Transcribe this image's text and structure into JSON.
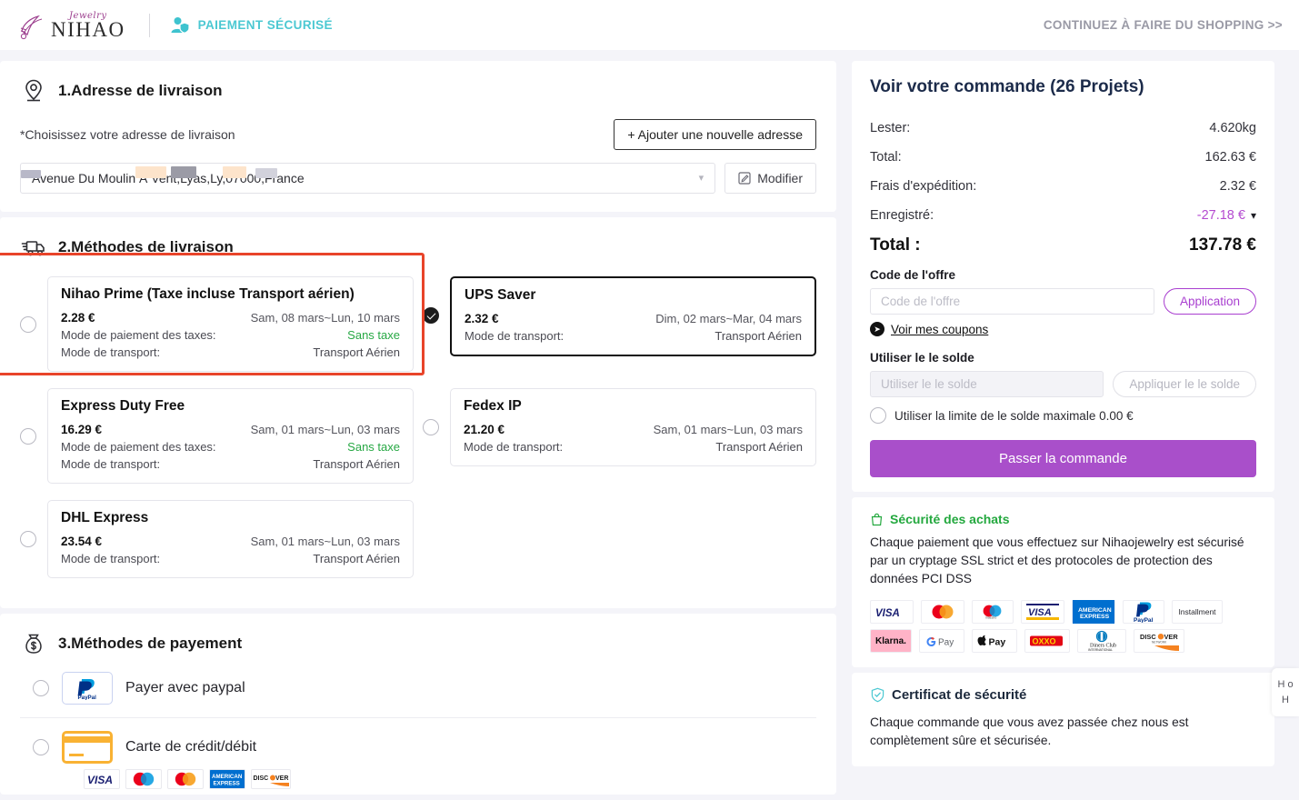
{
  "header": {
    "logo_script": "Jewelry",
    "logo_main": "NIHAO",
    "secure_payment": "PAIEMENT SÉCURISÉ",
    "continue_shopping": "CONTINUEZ À FAIRE DU SHOPPING >>"
  },
  "address_section": {
    "title": "1.Adresse de livraison",
    "hint": "*Choisissez votre adresse de livraison",
    "add_button": "+ Ajouter une nouvelle adresse",
    "selected_address": "Avenue Du Moulin À Vent,Lyas,Ly,07000,France",
    "modify_button": "Modifier"
  },
  "shipping_section": {
    "title": "2.Méthodes de livraison",
    "labels": {
      "tax_mode": "Mode de paiement des taxes:",
      "transport_mode": "Mode de transport:"
    },
    "options": [
      {
        "name": "Nihao Prime (Taxe incluse Transport aérien)",
        "price": "2.28 €",
        "date": "Sam, 08 mars~Lun, 10 mars",
        "tax_mode_label": "Mode de paiement des taxes:",
        "tax_mode_value": "Sans taxe",
        "transport_label": "Mode de transport:",
        "transport_value": "Transport Aérien",
        "selected": false,
        "highlighted": true
      },
      {
        "name": "UPS Saver",
        "price": "2.32 €",
        "date": "Dim, 02 mars~Mar, 04 mars",
        "tax_mode_label": "",
        "tax_mode_value": "",
        "transport_label": "Mode de transport:",
        "transport_value": "Transport Aérien",
        "selected": true,
        "highlighted": false
      },
      {
        "name": "Express Duty Free",
        "price": "16.29 €",
        "date": "Sam, 01 mars~Lun, 03 mars",
        "tax_mode_label": "Mode de paiement des taxes:",
        "tax_mode_value": "Sans taxe",
        "transport_label": "Mode de transport:",
        "transport_value": "Transport Aérien",
        "selected": false,
        "highlighted": false
      },
      {
        "name": "Fedex IP",
        "price": "21.20 €",
        "date": "Sam, 01 mars~Lun, 03 mars",
        "tax_mode_label": "",
        "tax_mode_value": "",
        "transport_label": "Mode de transport:",
        "transport_value": "Transport Aérien",
        "selected": false,
        "highlighted": false
      },
      {
        "name": "DHL Express",
        "price": "23.54 €",
        "date": "Sam, 01 mars~Lun, 03 mars",
        "tax_mode_label": "",
        "tax_mode_value": "",
        "transport_label": "Mode de transport:",
        "transport_value": "Transport Aérien",
        "selected": false,
        "highlighted": false
      }
    ]
  },
  "payment_section": {
    "title": "3.Méthodes de payement",
    "paypal_label": "Payer avec paypal",
    "card_label": "Carte de crédit/débit",
    "card_brands": [
      "VISA",
      "maestro",
      "mastercard",
      "AMERICAN EXPRESS",
      "DISCOVER"
    ]
  },
  "summary": {
    "title": "Voir votre commande (26 Projets)",
    "rows": [
      {
        "label": "Lester:",
        "value": "4.620kg"
      },
      {
        "label": "Total:",
        "value": "162.63 €"
      },
      {
        "label": "Frais d'expédition:",
        "value": "2.32 €"
      }
    ],
    "saved_label": "Enregistré:",
    "saved_value": "-27.18 €",
    "total_label": "Total :",
    "total_value": "137.78 €",
    "coupon_label": "Code de l'offre",
    "coupon_placeholder": "Code de l'offre",
    "coupon_value": "",
    "apply_button": "Application",
    "my_coupons_link": "Voir mes coupons",
    "balance_label": "Utiliser le le solde",
    "balance_placeholder": "Utiliser le le solde",
    "balance_value": "",
    "balance_apply_button": "Appliquer le le solde",
    "balance_max_label": "Utiliser la limite de le solde maximale 0.00 €",
    "place_order_button": "Passer la commande"
  },
  "trust": {
    "purchase_title": "Sécurité des achats",
    "purchase_body": "Chaque paiement que vous effectuez sur Nihaojewelry est sécurisé par un cryptage SSL strict et des protocoles de protection des données PCI DSS",
    "certificate_title": "Certificat de sécurité",
    "certificate_body": "Chaque commande que vous avez passée chez nous est complètement sûre et sécurisée.",
    "payment_logos": [
      "VISA",
      "mastercard",
      "maestro",
      "VISA",
      "AMERICAN EXPRESS",
      "PayPal",
      "Installment",
      "Klarna.",
      "G Pay",
      "Pay",
      "OXXO",
      "Diners Club INTERNATIONAL",
      "DISCOVER NETWORK"
    ]
  },
  "side_tab": {
    "text": "H o H"
  },
  "colors": {
    "accent_purple": "#a94fca",
    "teal": "#4bc8d2",
    "green": "#23a83e",
    "highlight_red": "#e8442a",
    "saved_purple": "#b44ad0"
  }
}
